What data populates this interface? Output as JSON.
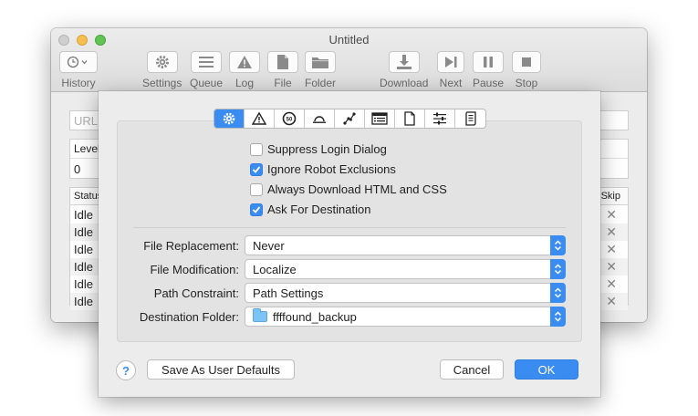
{
  "window": {
    "title": "Untitled",
    "toolbar": [
      {
        "label": "History",
        "icon": "history-clock-icon"
      },
      {
        "label": "Settings",
        "icon": "gear-icon"
      },
      {
        "label": "Queue",
        "icon": "queue-list-icon"
      },
      {
        "label": "Log",
        "icon": "warning-triangle-icon"
      },
      {
        "label": "File",
        "icon": "file-icon"
      },
      {
        "label": "Folder",
        "icon": "folder-icon"
      },
      {
        "label": "Download",
        "icon": "download-icon"
      },
      {
        "label": "Next",
        "icon": "next-icon"
      },
      {
        "label": "Pause",
        "icon": "pause-icon"
      },
      {
        "label": "Stop",
        "icon": "stop-icon"
      }
    ],
    "url_placeholder": "URL",
    "level_header": "Level",
    "level_value": "0",
    "status_header": "Status",
    "skip_header": "Skip",
    "status_rows": [
      "Idle",
      "Idle",
      "Idle",
      "Idle",
      "Idle",
      "Idle"
    ],
    "skip_glyph": "✕"
  },
  "sheet": {
    "tabs": [
      {
        "icon": "gear-icon",
        "active": true
      },
      {
        "icon": "warning-icon",
        "active": false
      },
      {
        "icon": "speed-limit-icon",
        "active": false
      },
      {
        "icon": "dome-icon",
        "active": false
      },
      {
        "icon": "link-graph-icon",
        "active": false
      },
      {
        "icon": "list-window-icon",
        "active": false
      },
      {
        "icon": "page-icon",
        "active": false
      },
      {
        "icon": "sliders-icon",
        "active": false
      },
      {
        "icon": "script-icon",
        "active": false
      }
    ],
    "checkboxes": [
      {
        "label": "Suppress Login Dialog",
        "checked": false
      },
      {
        "label": "Ignore Robot Exclusions",
        "checked": true
      },
      {
        "label": "Always Download HTML and CSS",
        "checked": false
      },
      {
        "label": "Ask For Destination",
        "checked": true
      }
    ],
    "fields": [
      {
        "label": "File Replacement:",
        "value": "Never"
      },
      {
        "label": "File Modification:",
        "value": "Localize"
      },
      {
        "label": "Path Constraint:",
        "value": "Path Settings"
      },
      {
        "label": "Destination Folder:",
        "value": "ffffound_backup"
      }
    ],
    "help_label": "?",
    "save_defaults_label": "Save As User Defaults",
    "cancel_label": "Cancel",
    "ok_label": "OK",
    "accent_color": "#3a8cf0"
  }
}
